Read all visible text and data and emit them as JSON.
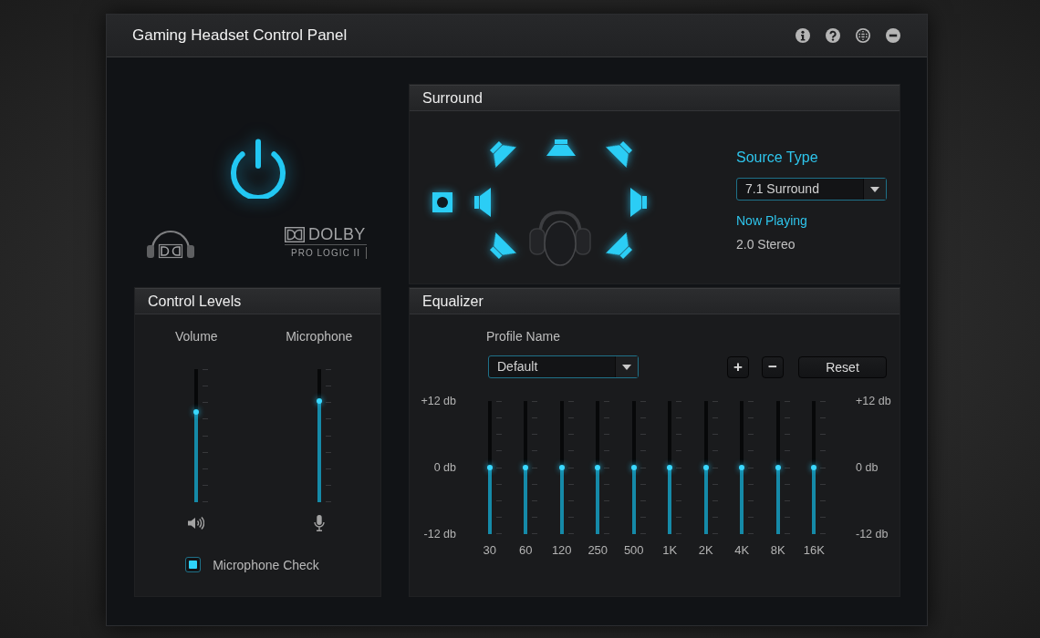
{
  "window": {
    "title": "Gaming Headset Control Panel"
  },
  "power": {
    "on": true
  },
  "logos": {
    "brand": "DOLBY",
    "subtitle": "PRO LOGIC II"
  },
  "surround": {
    "title": "Surround",
    "source_type_label": "Source Type",
    "source_type": "7.1 Surround",
    "now_playing_label": "Now Playing",
    "now_playing": "2.0 Stereo"
  },
  "control_levels": {
    "title": "Control Levels",
    "sliders": [
      {
        "kind": "speaker",
        "label": "Volume",
        "level": 0.68
      },
      {
        "kind": "microphone",
        "label": "Microphone",
        "level": 0.76
      }
    ],
    "microphone_check": {
      "label": "Microphone Check",
      "checked": true
    }
  },
  "equalizer": {
    "title": "Equalizer",
    "profile_label": "Profile Name",
    "profile": "Default",
    "add_button": "+",
    "remove_button": "−",
    "reset_button": "Reset",
    "scale_left": [
      "+12 db",
      "0 db",
      "-12 db"
    ],
    "scale_right": [
      "+12 db",
      "0 db",
      "-12 db"
    ],
    "bands": [
      {
        "label": "30",
        "level": 0.5
      },
      {
        "label": "60",
        "level": 0.5
      },
      {
        "label": "120",
        "level": 0.5
      },
      {
        "label": "250",
        "level": 0.5
      },
      {
        "label": "500",
        "level": 0.5
      },
      {
        "label": "1K",
        "level": 0.5
      },
      {
        "label": "2K",
        "level": 0.5
      },
      {
        "label": "4K",
        "level": 0.5
      },
      {
        "label": "8K",
        "level": 0.5
      },
      {
        "label": "16K",
        "level": 0.5
      }
    ]
  }
}
